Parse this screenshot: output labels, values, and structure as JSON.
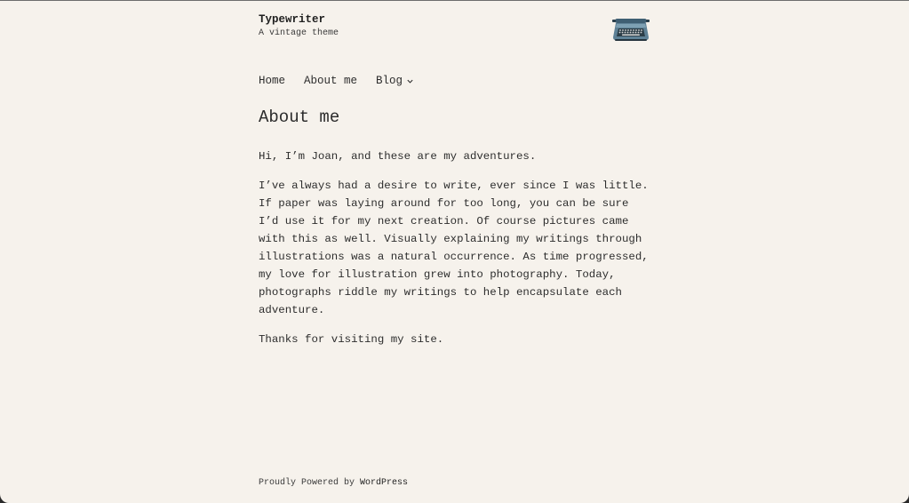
{
  "site": {
    "title": "Typewriter",
    "tagline": "A vintage theme",
    "logo_icon": "typewriter-icon"
  },
  "nav": {
    "items": [
      {
        "label": "Home"
      },
      {
        "label": "About me"
      },
      {
        "label": "Blog",
        "has_submenu": true
      }
    ]
  },
  "page": {
    "title": "About me",
    "paragraphs": [
      "Hi, I’m Joan, and these are my adventures.",
      "I’ve always had a desire to write, ever since I was little. If paper was laying around for too long, you can be sure I’d use it for my next creation. Of course pictures came with this as well. Visually explaining my writings through illustrations was a natural occurrence. As time progressed, my love for illustration grew into photography. Today, photographs riddle my writings to help encapsulate each adventure.",
      "Thanks for visiting my site."
    ]
  },
  "footer": {
    "prefix": "Proudly Powered by ",
    "link": "WordPress"
  },
  "colors": {
    "background": "#f6f2ec",
    "text": "#2d2d2d"
  }
}
